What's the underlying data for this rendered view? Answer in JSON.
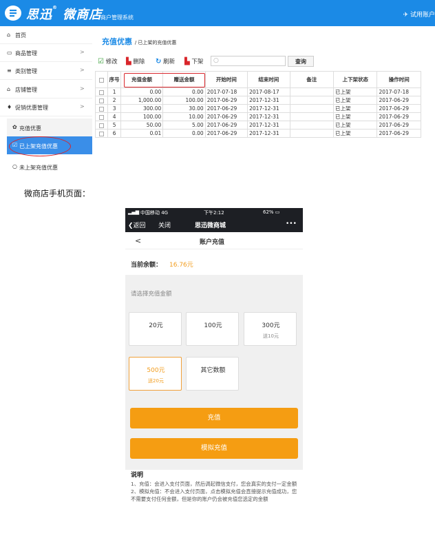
{
  "header": {
    "logo_text": "思迅",
    "logo_reg": "®",
    "logo_text2": "微商店",
    "subtitle": "商户管理系统",
    "trial": "试用账户"
  },
  "sidebar": {
    "items": [
      {
        "icon": "home-icon",
        "label": "首页",
        "chev": ""
      },
      {
        "icon": "goods-icon",
        "label": "商品管理",
        "chev": ">"
      },
      {
        "icon": "list-icon",
        "label": "类别管理",
        "chev": ">"
      },
      {
        "icon": "store-icon",
        "label": "店铺管理",
        "chev": ">"
      },
      {
        "icon": "promo-icon",
        "label": "促销优惠管理",
        "chev": ">"
      }
    ],
    "sub_items": [
      {
        "label": "充值优惠",
        "icon": "gear-icon"
      },
      {
        "label": "已上架充值优惠",
        "icon": "check-icon"
      },
      {
        "label": "未上架充值优惠",
        "icon": "circle-icon"
      }
    ]
  },
  "main": {
    "title": "充值优惠",
    "crumb": "/ 已上架的充值优惠"
  },
  "toolbar": {
    "edit": "修改",
    "delete": "删除",
    "refresh": "刷新",
    "offshelf": "下架",
    "search_placeholder": "",
    "query": "查询"
  },
  "table": {
    "headers": [
      "序号",
      "充值金额",
      "赠送金额",
      "开始时间",
      "结束时间",
      "备注",
      "上下架状态",
      "操作时间"
    ],
    "rows": [
      [
        "1",
        "0.00",
        "0.00",
        "2017-07-18",
        "2017-08-17",
        "",
        "已上架",
        "2017-07-18"
      ],
      [
        "2",
        "1,000.00",
        "100.00",
        "2017-06-29",
        "2017-12-31",
        "",
        "已上架",
        "2017-06-29"
      ],
      [
        "3",
        "300.00",
        "30.00",
        "2017-06-29",
        "2017-12-31",
        "",
        "已上架",
        "2017-06-29"
      ],
      [
        "4",
        "100.00",
        "10.00",
        "2017-06-29",
        "2017-12-31",
        "",
        "已上架",
        "2017-06-29"
      ],
      [
        "5",
        "50.00",
        "5.00",
        "2017-06-29",
        "2017-12-31",
        "",
        "已上架",
        "2017-06-29"
      ],
      [
        "6",
        "0.01",
        "0.00",
        "2017-06-29",
        "2017-12-31",
        "",
        "已上架",
        "2017-06-29"
      ]
    ]
  },
  "mobile_caption": "微商店手机页面：",
  "phone": {
    "status_left": "中国移动 4G",
    "status_time": "下午2:12",
    "status_right": "62%",
    "back": "返回",
    "close": "关闭",
    "app_title": "思迅微商城",
    "more": "•••",
    "page_title": "账户充值",
    "back_arrow": "<",
    "balance_label": "当前余额：",
    "balance_value": "16.76元",
    "choose": "请选择充值金额",
    "cards": [
      {
        "main": "20元",
        "sub": ""
      },
      {
        "main": "100元",
        "sub": ""
      },
      {
        "main": "300元",
        "sub": "送10元"
      },
      {
        "main": "500元",
        "sub": "送20元"
      },
      {
        "main": "其它数额",
        "sub": ""
      }
    ],
    "recharge": "充值",
    "sim_recharge": "模拟充值",
    "desc_title": "说明",
    "desc1": "1、充值：会进入支付页面，然后调起微信支付，您会真实的支付一定金额",
    "desc2": "2、模拟充值：不会进入支付页面，点击模拟充值会直接提示充值成功，您不需要支付任何金额，但是你的账户仍会被充值您选定的金额"
  }
}
